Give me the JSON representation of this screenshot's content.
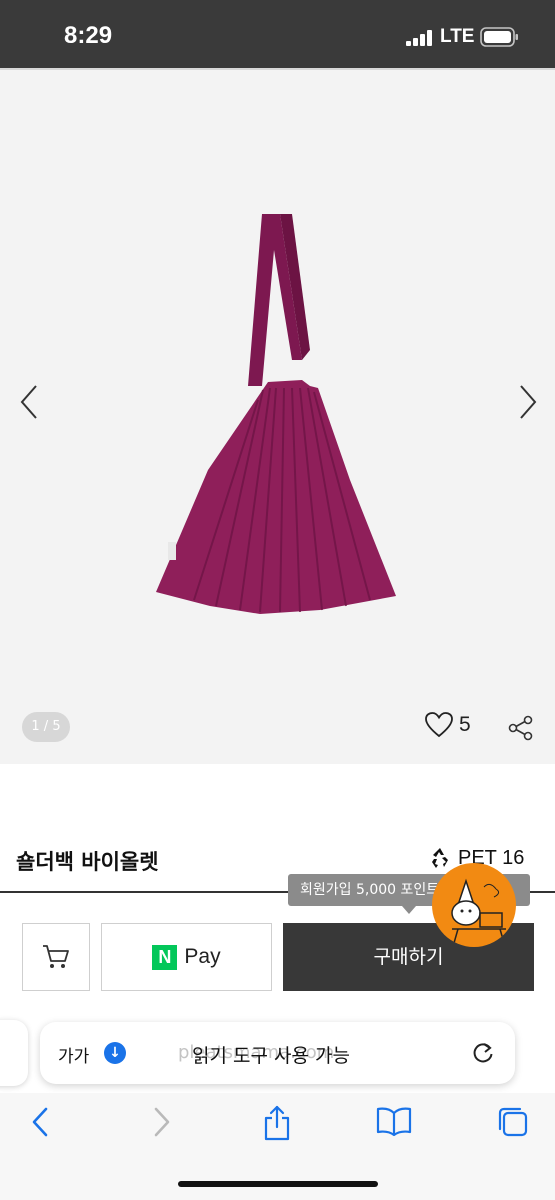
{
  "status_bar": {
    "time": "8:29",
    "network": "LTE"
  },
  "gallery": {
    "pager": "1 / 5",
    "like_count": "5"
  },
  "product": {
    "title": "숄더백 바이올렛",
    "badge": "PET 16"
  },
  "tooltip": {
    "text": "회원가입 5,000 포인트"
  },
  "buy_bar": {
    "pay_label": "Pay",
    "npay_letter": "N",
    "buy_label": "구매하기"
  },
  "safari": {
    "text_size": "가가",
    "ghost_url": "pleatsmama.com",
    "reader_label": "읽기 도구 사용 가능"
  },
  "colors": {
    "bag": "#8f1f5a",
    "buy_button": "#383838",
    "npay": "#03c75a",
    "mascot": "#f28a12",
    "safari_accent": "#1a73e8"
  },
  "icons": [
    "signal-icon",
    "battery-icon",
    "chevron-left-icon",
    "chevron-right-icon",
    "heart-icon",
    "share-icon",
    "recycle-icon",
    "cart-icon",
    "reload-icon",
    "back-icon",
    "forward-icon",
    "share-sheet-icon",
    "bookmarks-icon",
    "tabs-icon"
  ]
}
